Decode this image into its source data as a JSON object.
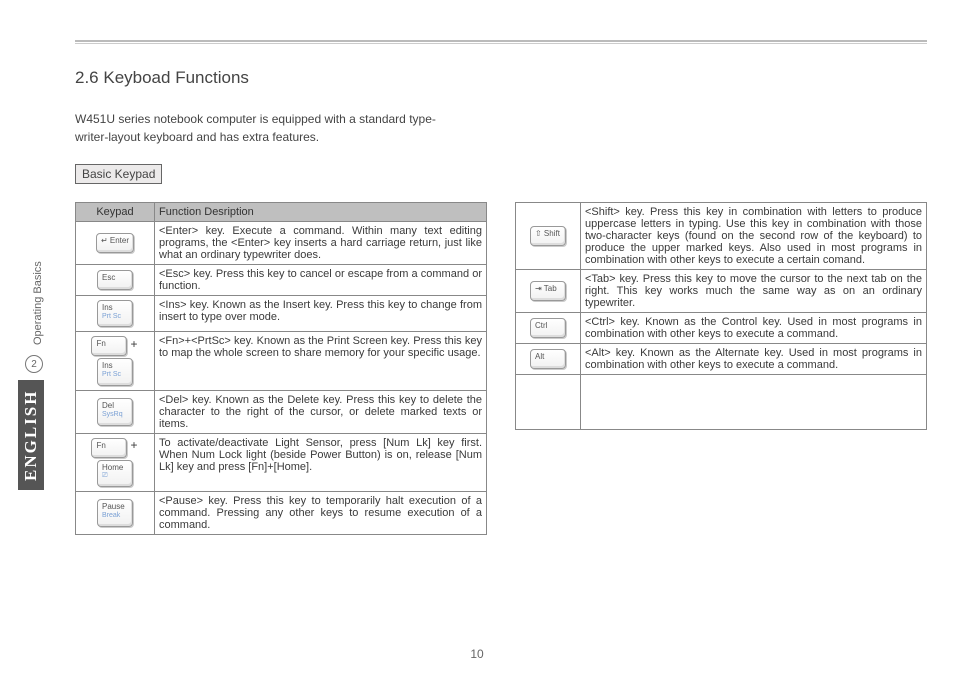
{
  "side": {
    "chapter_label": "Operating Basics",
    "badge": "2",
    "language": "ENGLISH"
  },
  "heading": "2.6 Keyboad Functions",
  "intro_line1": "W451U series notebook computer is equipped with a standard type-",
  "intro_line2": "writer-layout keyboard and has extra features.",
  "section_label": "Basic Keypad",
  "table_headers": {
    "keypad": "Keypad",
    "desc": "Function Desription"
  },
  "left_rows": [
    {
      "keys": [
        {
          "top": "↵ Enter"
        }
      ],
      "desc": "<Enter> key. Execute a command. Within many text editing programs, the <Enter> key inserts a hard carriage return, just like what an ordinary typewriter does."
    },
    {
      "keys": [
        {
          "top": "Esc"
        }
      ],
      "desc": "<Esc> key. Press this key to cancel or escape from a command or function."
    },
    {
      "keys": [
        {
          "top": "Ins",
          "sub": "Prt Sc"
        }
      ],
      "desc": "<Ins> key. Known as the Insert key. Press this key to change from insert to type over mode."
    },
    {
      "keys": [
        {
          "top": "Fn"
        },
        {
          "plus": true
        },
        {
          "top": "Ins",
          "sub": "Prt Sc"
        }
      ],
      "desc": "<Fn>+<PrtSc> key. Known as the Print Screen key. Press this key to map the whole screen to share memory for your specific usage."
    },
    {
      "keys": [
        {
          "top": "Del",
          "sub": "SysRq"
        }
      ],
      "desc": "<Del> key. Known as the Delete key. Press this key to delete the character to the right of the cursor, or delete marked texts or items."
    },
    {
      "keys": [
        {
          "top": "Fn"
        },
        {
          "plus": true
        },
        {
          "top": "Home",
          "sub": "⎚"
        }
      ],
      "desc": "To activate/deactivate Light Sensor, press [Num Lk] key first.  When Num Lock light (beside Power Button) is on, release [Num Lk] key and press [Fn]+[Home]."
    },
    {
      "keys": [
        {
          "top": "Pause",
          "sub": "Break"
        }
      ],
      "desc": "<Pause> key. Press this key to temporarily halt execution of a command. Pressing any other keys to resume execution of a command."
    }
  ],
  "right_rows": [
    {
      "keys": [
        {
          "top": "⇧ Shift"
        }
      ],
      "desc": "<Shift> key.  Press this key in combination with letters to produce uppercase letters in typing. Use this key in combination with those two-character keys (found on the second row of the keyboard) to produce the upper marked keys. Also used in most programs in combination with other keys to execute a certain comand."
    },
    {
      "keys": [
        {
          "top": "⇥ Tab"
        }
      ],
      "desc": "<Tab> key. Press this key to move the cursor to the next tab on the right. This key works much the same way as on an ordinary typewriter."
    },
    {
      "keys": [
        {
          "top": "Ctrl"
        }
      ],
      "desc": "<Ctrl> key. Known as the Control key. Used in most programs in combination with other keys to execute a command."
    },
    {
      "keys": [
        {
          "top": "Alt"
        }
      ],
      "desc": "<Alt> key. Known as the Alternate key. Used in most programs in combination with other keys to execute a command."
    }
  ],
  "page_number": "10"
}
